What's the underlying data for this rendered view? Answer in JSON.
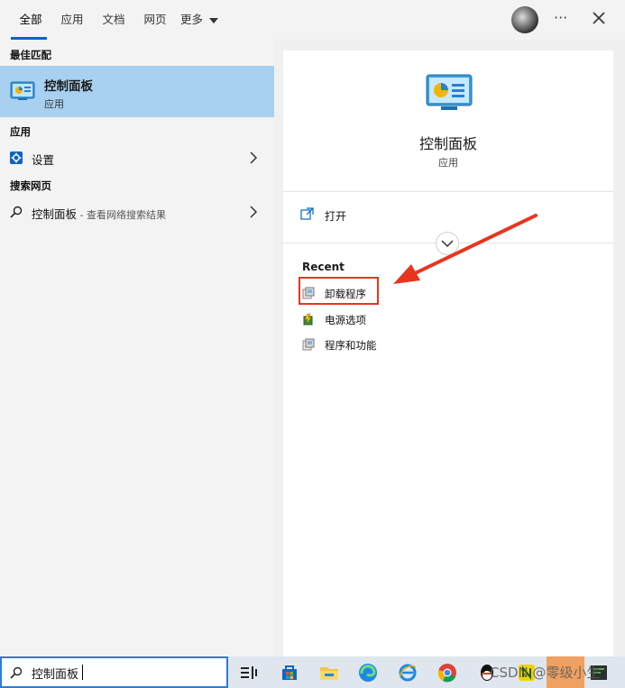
{
  "tabs": [
    {
      "label": "全部"
    },
    {
      "label": "应用"
    },
    {
      "label": "文档"
    },
    {
      "label": "网页"
    },
    {
      "label": "更多"
    }
  ],
  "left": {
    "best_match_heading": "最佳匹配",
    "best_match": {
      "title": "控制面板",
      "subtitle": "应用"
    },
    "apps_heading": "应用",
    "apps": [
      {
        "label": "设置"
      }
    ],
    "web_heading": "搜索网页",
    "web": [
      {
        "label": "控制面板",
        "suffix": " - 查看网络搜索结果"
      }
    ]
  },
  "right": {
    "title": "控制面板",
    "subtitle": "应用",
    "open_label": "打开",
    "recent_heading": "Recent",
    "recent": [
      {
        "label": "卸载程序"
      },
      {
        "label": "电源选项"
      },
      {
        "label": "程序和功能"
      }
    ]
  },
  "search": {
    "value": "控制面板"
  },
  "watermark": "CSDN @零级小生",
  "colors": {
    "accent": "#0067c0",
    "highlight": "#a8d0f0",
    "annotation": "#e8351e"
  }
}
